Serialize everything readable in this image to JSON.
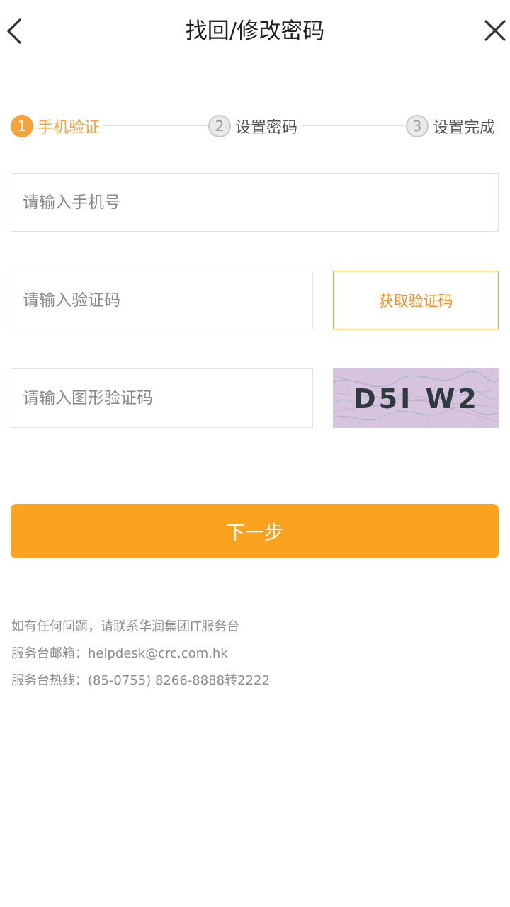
{
  "header": {
    "title": "找回/修改密码",
    "back_icon": "chevron-left-icon",
    "close_icon": "close-icon"
  },
  "steps": [
    {
      "number": "1",
      "label": "手机验证",
      "active": true
    },
    {
      "number": "2",
      "label": "设置密码",
      "active": false
    },
    {
      "number": "3",
      "label": "设置完成",
      "active": false
    }
  ],
  "form": {
    "phone_placeholder": "请输入手机号",
    "sms_code_placeholder": "请输入验证码",
    "get_code_label": "获取验证码",
    "captcha_placeholder": "请输入图形验证码",
    "captcha_text": "D5I W2",
    "next_label": "下一步"
  },
  "help": {
    "line1": "如有任何问题，请联系华润集团IT服务台",
    "line2": "服务台邮箱：helpdesk@crc.com.hk",
    "line3": "服务台热线：(85-0755) 8266-8888转2222"
  },
  "colors": {
    "accent": "#f7a23a",
    "button": "#fba21f"
  }
}
